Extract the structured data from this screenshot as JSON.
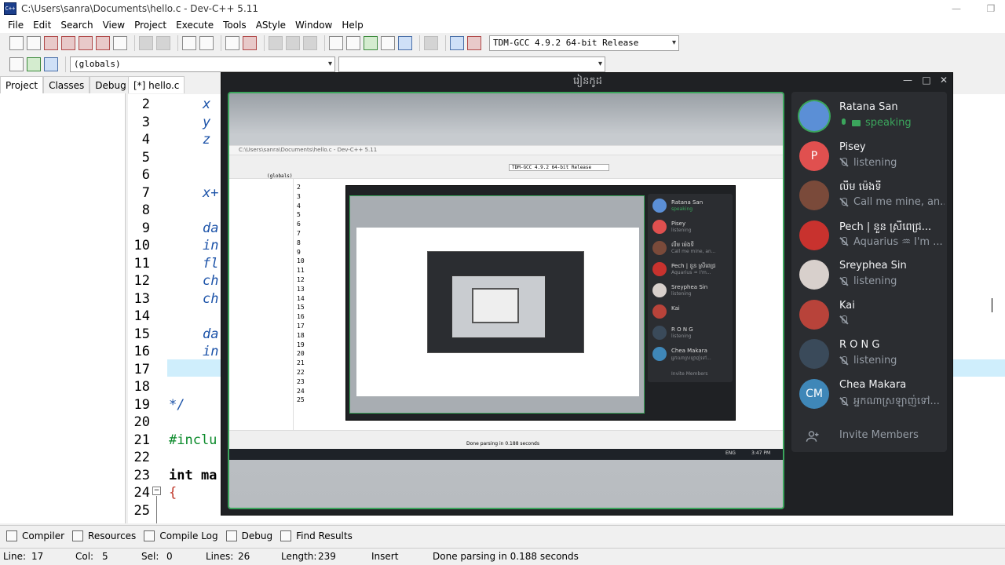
{
  "window": {
    "title": "C:\\Users\\sanra\\Documents\\hello.c - Dev-C++ 5.11",
    "icon": "devcpp-icon"
  },
  "menu": [
    "File",
    "Edit",
    "Search",
    "View",
    "Project",
    "Execute",
    "Tools",
    "AStyle",
    "Window",
    "Help"
  ],
  "toolbar": {
    "compiler_select": "TDM-GCC 4.9.2 64-bit Release",
    "scope_select": "(globals)",
    "member_select": ""
  },
  "left_panel": {
    "tabs": [
      "Project",
      "Classes",
      "Debug"
    ],
    "active_tab": "Project"
  },
  "editor": {
    "tab": "[*] hello.c",
    "lines": [
      {
        "num": "2",
        "text": "x",
        "style": "it"
      },
      {
        "num": "3",
        "text": "y",
        "style": "it"
      },
      {
        "num": "4",
        "text": "z",
        "style": "it"
      },
      {
        "num": "5",
        "text": "",
        "style": ""
      },
      {
        "num": "6",
        "text": "",
        "style": ""
      },
      {
        "num": "7",
        "text": "x+",
        "style": "it"
      },
      {
        "num": "8",
        "text": "",
        "style": ""
      },
      {
        "num": "9",
        "text": "da",
        "style": "it"
      },
      {
        "num": "10",
        "text": "in",
        "style": "it"
      },
      {
        "num": "11",
        "text": "fl",
        "style": "it"
      },
      {
        "num": "12",
        "text": "ch",
        "style": "it"
      },
      {
        "num": "13",
        "text": "ch",
        "style": "it"
      },
      {
        "num": "14",
        "text": "",
        "style": ""
      },
      {
        "num": "15",
        "text": "da",
        "style": "it"
      },
      {
        "num": "16",
        "text": "in",
        "style": "it"
      },
      {
        "num": "17",
        "text": "",
        "style": ""
      },
      {
        "num": "18",
        "text": "",
        "style": ""
      },
      {
        "num": "19",
        "text": "*/",
        "style": "cm"
      },
      {
        "num": "20",
        "text": "",
        "style": ""
      },
      {
        "num": "21",
        "text": "#inclu",
        "style": "inc"
      },
      {
        "num": "22",
        "text": "",
        "style": ""
      },
      {
        "num": "23",
        "text": "int ma",
        "style": "kw"
      },
      {
        "num": "24",
        "text": "{",
        "style": "brace"
      },
      {
        "num": "25",
        "text": "",
        "style": ""
      }
    ]
  },
  "bottom_tabs": [
    "Compiler",
    "Resources",
    "Compile Log",
    "Debug",
    "Find Results"
  ],
  "status": {
    "line_label": "Line:",
    "line": "17",
    "col_label": "Col:",
    "col": "5",
    "sel_label": "Sel:",
    "sel": "0",
    "lines_label": "Lines:",
    "lines": "26",
    "length_label": "Length:",
    "length": "239",
    "mode": "Insert",
    "message": "Done parsing in 0.188 seconds"
  },
  "discord": {
    "title": "រៀនកូដ",
    "members": [
      {
        "name": "Ratana San",
        "status": "speaking",
        "avatar_text": "",
        "avatar_color": "#5b8fd6",
        "state": "speaking"
      },
      {
        "name": "Pisey",
        "status": "listening",
        "avatar_text": "P",
        "avatar_color": "#e0504f",
        "state": "muted"
      },
      {
        "name": "លឹម ម៉េងទី",
        "status": "Call me mine, an...",
        "avatar_text": "",
        "avatar_color": "#7a4a3a",
        "state": "muted"
      },
      {
        "name": "Pech | នួន ស្រីពេជ្រ...",
        "status": "Aquarius ♒ I'm ...",
        "avatar_text": "",
        "avatar_color": "#c8322e",
        "state": "muted"
      },
      {
        "name": "Sreyphea Sin",
        "status": "listening",
        "avatar_text": "",
        "avatar_color": "#d8d0cc",
        "state": "muted"
      },
      {
        "name": "Kai",
        "status": "",
        "avatar_text": "",
        "avatar_color": "#b8433a",
        "state": "muted"
      },
      {
        "name": "R O N G",
        "status": "listening",
        "avatar_text": "",
        "avatar_color": "#3a4a5a",
        "state": "muted"
      },
      {
        "name": "Chea Makara",
        "status": "អ្នកណាស្រឡាញ់ទៅ...",
        "avatar_text": "CM",
        "avatar_color": "#3f87b8",
        "state": "muted"
      }
    ],
    "invite_label": "Invite Members"
  },
  "stream": {
    "mini_window_title": "C:\\Users\\sanra\\Documents\\hello.c - Dev-C++ 5.11",
    "mini_compiler": "TDM-GCC 4.9.2 64-bit Release",
    "mini_globals": "(globals)",
    "mini_status": "Done parsing in 0.188 seconds",
    "mini_clock": "3:47 PM",
    "mini_lang": "ENG",
    "mini_members": [
      "Ratana San",
      "Pisey",
      "លឹម ម៉េងទី",
      "Pech | នួន ស្រីពេជ្រ",
      "Sreyphea Sin",
      "Kai",
      "R O N G",
      "Chea Makara"
    ],
    "mini_sub": [
      "speaking",
      "listening",
      "Call me mine, an...",
      "Aquarius ♒ I'm...",
      "listening",
      "",
      "listening",
      "អ្នកណាស្រឡាញ់ទៅ..."
    ],
    "mini_invite": "Invite Members",
    "mini_lines": [
      "2",
      "3",
      "4",
      "5",
      "6",
      "7",
      "8",
      "9",
      "10",
      "11",
      "12",
      "13",
      "14",
      "15",
      "16",
      "17",
      "18",
      "19",
      "20",
      "21",
      "22",
      "23",
      "24",
      "25"
    ]
  }
}
